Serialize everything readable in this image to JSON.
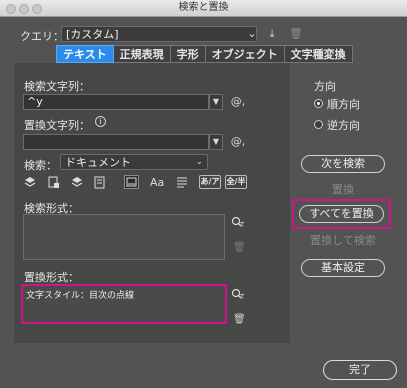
{
  "window": {
    "title": "検索と置換"
  },
  "query": {
    "label": "クエリ：",
    "value": "[カスタム]"
  },
  "tabs": [
    {
      "label": "テキスト",
      "active": true
    },
    {
      "label": "正規表現",
      "active": false
    },
    {
      "label": "字形",
      "active": false
    },
    {
      "label": "オブジェクト",
      "active": false
    },
    {
      "label": "文字種変換",
      "active": false
    }
  ],
  "find": {
    "label": "検索文字列：",
    "value": "^y"
  },
  "change": {
    "label": "置換文字列：",
    "value": ""
  },
  "search_scope": {
    "label": "検索：",
    "value": "ドキュメント"
  },
  "option_icons": [
    "lock-layer-icon",
    "lock-page-icon",
    "layers-icon",
    "master-page-icon",
    "footnote-icon",
    "case-sensitive-icon",
    "whole-word-icon",
    "kana-sensitive-icon",
    "width-sensitive-icon"
  ],
  "option_labels": {
    "case": "Aa",
    "kana": "あ/ア",
    "width": "全/半"
  },
  "find_format": {
    "label": "検索形式：",
    "value": ""
  },
  "change_format": {
    "label": "置換形式：",
    "value": "文字スタイル：目次の点線"
  },
  "direction": {
    "label": "方向",
    "options": [
      {
        "label": "順方向",
        "selected": true
      },
      {
        "label": "逆方向",
        "selected": false
      }
    ]
  },
  "buttons": {
    "find_next": "次を検索",
    "change": "置換",
    "change_all": "すべてを置換",
    "change_find": "置換して検索",
    "fewer_options": "基本設定",
    "done": "完了"
  },
  "colors": {
    "accent": "#2d8ceb",
    "highlight": "#d0158a",
    "background": "#535353"
  }
}
